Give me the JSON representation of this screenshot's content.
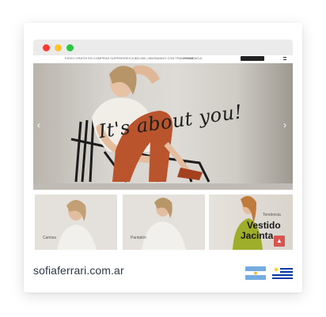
{
  "site": {
    "url": "sofiaferrari.com.ar"
  },
  "topbar": {
    "announcement": "ENVIO GRATIS EN COMPRAS SUPERIORES A $25.000 | ABONANDO CON TRANSFERENCIA",
    "search_placeholder": "Buscar...",
    "login_label": "INGRESAR"
  },
  "hero": {
    "slogan": "It's about you!",
    "prev_arrow": "‹",
    "next_arrow": "›"
  },
  "thumbs": [
    {
      "caption": "Camisa"
    },
    {
      "caption": "Pantalón"
    },
    {
      "eyebrow": "Tendencia",
      "title_line1": "Vestido",
      "title_line2": "Jacinta"
    }
  ],
  "buttons": {
    "scroll_top": "▲"
  },
  "flags": [
    {
      "name": "argentina-flag",
      "colors": [
        "#74acdf",
        "#ffffff",
        "#74acdf"
      ],
      "sun": "#f6b40e"
    },
    {
      "name": "uruguay-flag",
      "colors": [
        "#ffffff",
        "#0038a8"
      ],
      "sun": "#fcd116"
    }
  ],
  "colors": {
    "accent_red": "#d9534f",
    "whatsapp_green": "#25d366",
    "url_text": "#2c3948"
  }
}
